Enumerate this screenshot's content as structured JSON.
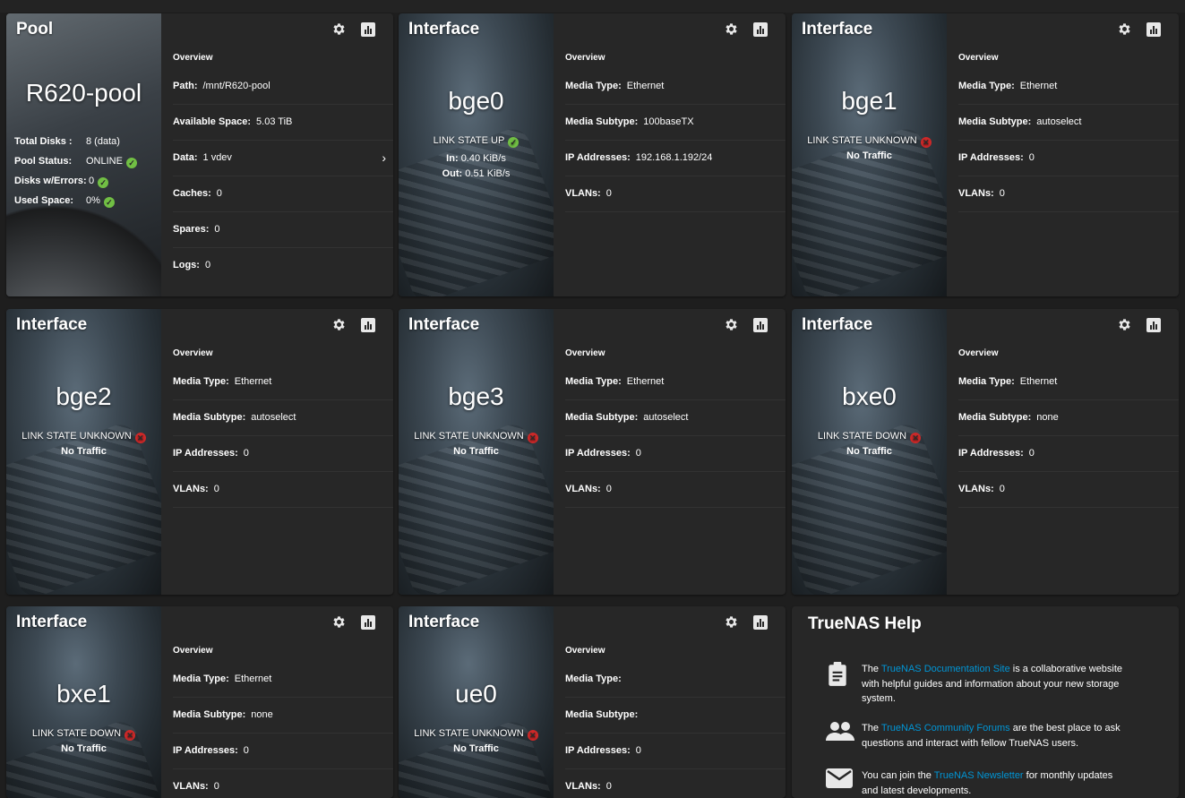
{
  "overview_label": "Overview",
  "pool": {
    "title": "Pool",
    "name": "R620-pool",
    "stats": [
      {
        "key": "Total Disks :",
        "value": "8 (data)",
        "ok": false
      },
      {
        "key": "Pool Status:",
        "value": "ONLINE",
        "ok": true
      },
      {
        "key": "Disks w/Errors:",
        "value": "0",
        "ok": true
      },
      {
        "key": "Used Space:",
        "value": "0%",
        "ok": true
      }
    ],
    "rows": [
      {
        "key": "Path:",
        "value": "/mnt/R620-pool"
      },
      {
        "key": "Available Space:",
        "value": "5.03 TiB"
      },
      {
        "key": "Data:",
        "value": "1 vdev"
      },
      {
        "key": "Caches:",
        "value": "0"
      },
      {
        "key": "Spares:",
        "value": "0"
      },
      {
        "key": "Logs:",
        "value": "0"
      }
    ]
  },
  "interfaces": [
    {
      "title": "Interface",
      "name": "bge0",
      "state": "LINK STATE UP",
      "state_ok": true,
      "traffic_in": "0.40 KiB/s",
      "traffic_out": "0.51 KiB/s",
      "no_traffic": "",
      "media_type": "Ethernet",
      "media_subtype": "100baseTX",
      "ip": "192.168.1.192/24",
      "vlans": "0"
    },
    {
      "title": "Interface",
      "name": "bge1",
      "state": "LINK STATE UNKNOWN",
      "state_ok": false,
      "no_traffic": "No Traffic",
      "media_type": "Ethernet",
      "media_subtype": "autoselect",
      "ip": "0",
      "vlans": "0"
    },
    {
      "title": "Interface",
      "name": "bge2",
      "state": "LINK STATE UNKNOWN",
      "state_ok": false,
      "no_traffic": "No Traffic",
      "media_type": "Ethernet",
      "media_subtype": "autoselect",
      "ip": "0",
      "vlans": "0"
    },
    {
      "title": "Interface",
      "name": "bge3",
      "state": "LINK STATE UNKNOWN",
      "state_ok": false,
      "no_traffic": "No Traffic",
      "media_type": "Ethernet",
      "media_subtype": "autoselect",
      "ip": "0",
      "vlans": "0"
    },
    {
      "title": "Interface",
      "name": "bxe0",
      "state": "LINK STATE DOWN",
      "state_ok": false,
      "no_traffic": "No Traffic",
      "media_type": "Ethernet",
      "media_subtype": "none",
      "ip": "0",
      "vlans": "0"
    },
    {
      "title": "Interface",
      "name": "bxe1",
      "state": "LINK STATE DOWN",
      "state_ok": false,
      "no_traffic": "No Traffic",
      "media_type": "Ethernet",
      "media_subtype": "none",
      "ip": "0",
      "vlans": "0"
    },
    {
      "title": "Interface",
      "name": "ue0",
      "state": "LINK STATE UNKNOWN",
      "state_ok": false,
      "no_traffic": "No Traffic",
      "media_type": "",
      "media_subtype": "",
      "ip": "0",
      "vlans": "0"
    }
  ],
  "labels": {
    "media_type": "Media Type:",
    "media_subtype": "Media Subtype:",
    "ip": "IP Addresses:",
    "vlans": "VLANs:",
    "in": "In:",
    "out": "Out:"
  },
  "help": {
    "title": "TrueNAS Help",
    "items": [
      {
        "icon": "clipboard-icon",
        "pre": "The ",
        "link": "TrueNAS Documentation Site",
        "post": " is a collaborative website with helpful guides and information about your new storage system."
      },
      {
        "icon": "people-icon",
        "pre": "The ",
        "link": "TrueNAS Community Forums",
        "post": " are the best place to ask questions and interact with fellow TrueNAS users."
      },
      {
        "icon": "mail-icon",
        "pre": "You can join the ",
        "link": "TrueNAS Newsletter",
        "post": " for monthly updates and latest developments."
      }
    ]
  },
  "colors": {
    "ok": "#71bf44",
    "error": "#ce2929",
    "link": "#0095d5",
    "card": "#272727"
  }
}
